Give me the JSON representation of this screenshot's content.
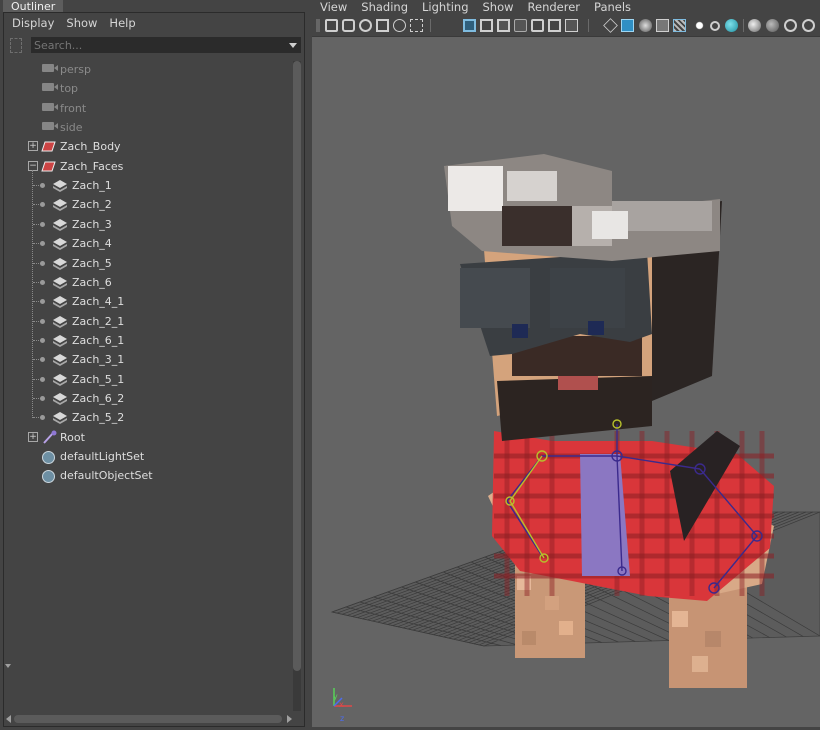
{
  "outliner": {
    "tab_label": "Outliner",
    "menu": [
      "Display",
      "Show",
      "Help"
    ],
    "search_placeholder": "Search...",
    "tree": [
      {
        "label": "persp",
        "icon": "camera-icon",
        "dimmed": true
      },
      {
        "label": "top",
        "icon": "camera-icon",
        "dimmed": true
      },
      {
        "label": "front",
        "icon": "camera-icon",
        "dimmed": true
      },
      {
        "label": "side",
        "icon": "camera-icon",
        "dimmed": true
      },
      {
        "label": "Zach_Body",
        "icon": "mesh-icon",
        "expander": "+"
      },
      {
        "label": "Zach_Faces",
        "icon": "mesh-icon",
        "expander": "−"
      },
      {
        "label": "Zach_1",
        "icon": "group-icon",
        "child": true
      },
      {
        "label": "Zach_2",
        "icon": "group-icon",
        "child": true
      },
      {
        "label": "Zach_3",
        "icon": "group-icon",
        "child": true
      },
      {
        "label": "Zach_4",
        "icon": "group-icon",
        "child": true
      },
      {
        "label": "Zach_5",
        "icon": "group-icon",
        "child": true
      },
      {
        "label": "Zach_6",
        "icon": "group-icon",
        "child": true
      },
      {
        "label": "Zach_4_1",
        "icon": "group-icon",
        "child": true
      },
      {
        "label": "Zach_2_1",
        "icon": "group-icon",
        "child": true
      },
      {
        "label": "Zach_6_1",
        "icon": "group-icon",
        "child": true
      },
      {
        "label": "Zach_3_1",
        "icon": "group-icon",
        "child": true
      },
      {
        "label": "Zach_5_1",
        "icon": "group-icon",
        "child": true
      },
      {
        "label": "Zach_6_2",
        "icon": "group-icon",
        "child": true
      },
      {
        "label": "Zach_5_2",
        "icon": "group-icon",
        "child": true
      },
      {
        "label": "Root",
        "icon": "joint-icon",
        "expander": "+"
      },
      {
        "label": "defaultLightSet",
        "icon": "set-icon"
      },
      {
        "label": "defaultObjectSet",
        "icon": "set-icon"
      }
    ]
  },
  "viewport": {
    "menu": [
      "View",
      "Shading",
      "Lighting",
      "Show",
      "Renderer",
      "Panels"
    ],
    "axis": {
      "x": "x",
      "y": "y",
      "z": "z"
    }
  },
  "colors": {
    "panel_bg": "#444444",
    "viewport_bg": "#646464",
    "flannel_red": "#d9363a",
    "shirt_purple": "#8b77c2",
    "skin": "#d8a57a",
    "hair_dark": "#2b2523",
    "glasses": "#3a3e42",
    "joint_purple": "#3b2a8c",
    "joint_yellow": "#b7c02c"
  }
}
